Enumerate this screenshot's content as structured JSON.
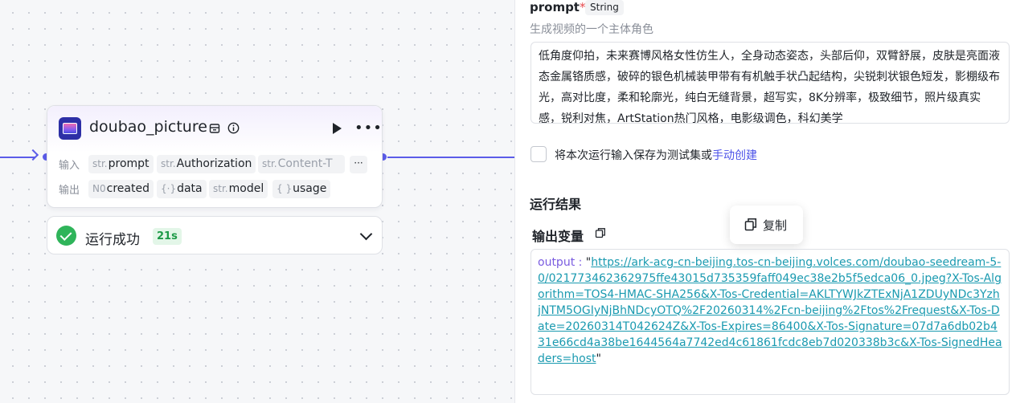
{
  "node": {
    "title": "doubao_picture",
    "input_label": "输入",
    "output_label": "输出",
    "inputs": [
      {
        "type": "str.",
        "name": "prompt"
      },
      {
        "type": "str.",
        "name": "Authorization"
      },
      {
        "type": "str.",
        "name": "Content-T"
      }
    ],
    "outputs": [
      {
        "type": "N0",
        "name": "created"
      },
      {
        "type": "{·}",
        "name": "data"
      },
      {
        "type": "str.",
        "name": "model"
      },
      {
        "type": "{ }",
        "name": "usage"
      }
    ],
    "more_label": "···",
    "icons": {
      "db": "database-icon",
      "info": "info-icon",
      "run": "play-icon",
      "more": "more-icon"
    }
  },
  "status": {
    "text": "运行成功",
    "duration": "21s",
    "color": "#2fb45a"
  },
  "panel": {
    "prompt_label": "prompt",
    "required_mark": "*",
    "prompt_type": "String",
    "prompt_desc": "生成视频的一个主体角色",
    "prompt_value": "低角度仰拍，未来赛博风格女性仿生人，全身动态姿态，头部后仰，双臂舒展，皮肤是亮面液态金属铬质感，破碎的银色机械装甲带有有机触手状凸起结构，尖锐刺状银色短发，影棚级布光，高对比度，柔和轮廓光，纯白无缝背景，超写实，8K分辨率，极致细节，照片级真实感，锐利对焦，ArtStation热门风格，电影级调色，科幻美学",
    "save_text": "将本次运行输入保存为测试集或",
    "save_link": "手动创建",
    "result_title": "运行结果",
    "output_var_title": "输出变量",
    "copy_label": "复制",
    "output_key": "output : ",
    "output_quote_open": "\"",
    "output_value": "https://ark-acg-cn-beijing.tos-cn-beijing.volces.com/doubao-seedream-5-0/021773462362975ffe43015d735359faff049ec38e2b5f5edca06_0.jpeg?X-Tos-Algorithm=TOS4-HMAC-SHA256&X-Tos-Credential=AKLTYWJkZTExNjA1ZDUyNDc3YzhjNTM5OGIyNjBhNDcyOTQ%2F20260314%2Fcn-beijing%2Ftos%2Frequest&X-Tos-Date=20260314T042624Z&X-Tos-Expires=86400&X-Tos-Signature=07d7a6db02b431e66cd4a38be1644564a7742ed4c61861fcdc8eb7d020338b3c&X-Tos-SignedHeaders=host",
    "output_quote_close": "\"",
    "accent": "#4d53e8"
  }
}
